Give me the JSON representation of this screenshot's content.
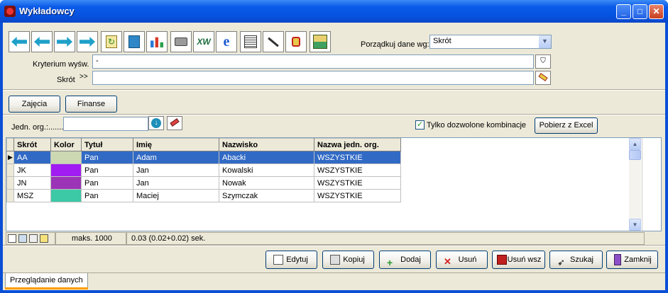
{
  "window": {
    "title": "Wykładowcy"
  },
  "toolbar": {
    "icons": [
      "first-icon",
      "prev-icon",
      "next-icon",
      "last-icon",
      "refresh-icon",
      "copy-icon",
      "chart-icon",
      "print-icon",
      "excel-icon",
      "browser-icon",
      "report-icon",
      "wand-icon",
      "config-icon",
      "sql-icon"
    ],
    "sort_label": "Porządkuj dane wg:",
    "sort_value": "Skrót"
  },
  "filters": {
    "criteria_label": "Kryterium wyśw.",
    "criteria_value": "-",
    "skrot_label": "Skrót",
    "skrot_prefix": ">>",
    "skrot_value": ""
  },
  "buttons": {
    "zajecia": "Zajęcia",
    "finanse": "Finanse"
  },
  "unit": {
    "label": "Jedn. org.:.......",
    "value": "",
    "checkbox_label": "Tylko dozwolone kombinacje",
    "checkbox_checked": true,
    "excel_button": "Pobierz z Excel"
  },
  "grid": {
    "columns": [
      "Skrót",
      "Kolor",
      "Tytuł",
      "Imię",
      "Nazwisko",
      "Nazwa jedn. org."
    ],
    "rows": [
      {
        "skrot": "AA",
        "kolor": "#cbd8b2",
        "tytul": "Pan",
        "imie": "Adam",
        "nazwisko": "Abacki",
        "jedn": "WSZYSTKIE"
      },
      {
        "skrot": "JK",
        "kolor": "#a11cf0",
        "tytul": "Pan",
        "imie": "Jan",
        "nazwisko": "Kowalski",
        "jedn": "WSZYSTKIE"
      },
      {
        "skrot": "JN",
        "kolor": "#9b34b6",
        "tytul": "Pan",
        "imie": "Jan",
        "nazwisko": "Nowak",
        "jedn": "WSZYSTKIE"
      },
      {
        "skrot": "MSZ",
        "kolor": "#3cc9a6",
        "tytul": "Pan",
        "imie": "Maciej",
        "nazwisko": "Szymczak",
        "jedn": "WSZYSTKIE"
      }
    ]
  },
  "status": {
    "max": "maks. 1000",
    "timing": "0.03 (0.02+0.02) sek."
  },
  "actions": {
    "edytuj": "Edytuj",
    "kopiuj": "Kopiuj",
    "dodaj": "Dodaj",
    "usun": "Usuń",
    "usun_wsz": "Usuń wsz",
    "szukaj": "Szukaj",
    "zamknij": "Zamknij"
  },
  "tabs": {
    "browse": "Przeglądanie danych"
  }
}
